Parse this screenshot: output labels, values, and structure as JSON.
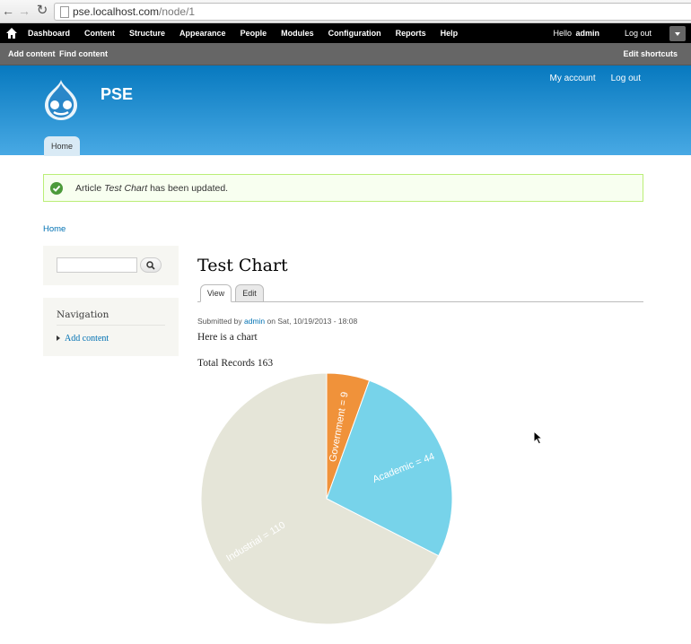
{
  "browser": {
    "url_host": "pse.localhost.com",
    "url_path": "/node/1",
    "back_glyph": "←",
    "forward_glyph": "→",
    "reload_glyph": "↻"
  },
  "admin_toolbar": {
    "menu": [
      "Dashboard",
      "Content",
      "Structure",
      "Appearance",
      "People",
      "Modules",
      "Configuration",
      "Reports",
      "Help"
    ],
    "greeting": "Hello",
    "user": "admin",
    "logout": "Log out"
  },
  "shortcuts": {
    "add_content": "Add content",
    "find_content": "Find content",
    "edit_shortcuts": "Edit shortcuts"
  },
  "header": {
    "site_name": "PSE",
    "my_account": "My account",
    "log_out": "Log out",
    "main_menu_home": "Home"
  },
  "message": {
    "prefix": "Article",
    "title": "Test Chart",
    "suffix": "has been updated."
  },
  "breadcrumb": "Home",
  "sidebar": {
    "search_placeholder": "",
    "navigation_title": "Navigation",
    "navigation_link": "Add content"
  },
  "content": {
    "title": "Test Chart",
    "tab_view": "View",
    "tab_edit": "Edit",
    "submitted_by": "Submitted by",
    "author": "admin",
    "submitted_on": "on Sat, 10/19/2013 - 18:08",
    "body": "Here is a chart",
    "total_records": "Total Records 163"
  },
  "colors": {
    "header_top": "#0779bf",
    "header_bottom": "#48a9e4",
    "link": "#0071b3",
    "message_border": "#bbee77",
    "check_green": "#4c9a3b"
  },
  "chart_data": {
    "type": "pie",
    "slices": [
      {
        "label": "Government",
        "value": 9,
        "text": "Government = 9",
        "color": "#f0923a"
      },
      {
        "label": "Academic",
        "value": 44,
        "text": "Academic = 44",
        "color": "#77d3ea"
      },
      {
        "label": "Industrial",
        "value": 110,
        "text": "Industrial = 110",
        "color": "#e5e5d8"
      }
    ],
    "total": 163,
    "start": "12 o'clock",
    "direction": "clockwise",
    "legend": "none"
  }
}
